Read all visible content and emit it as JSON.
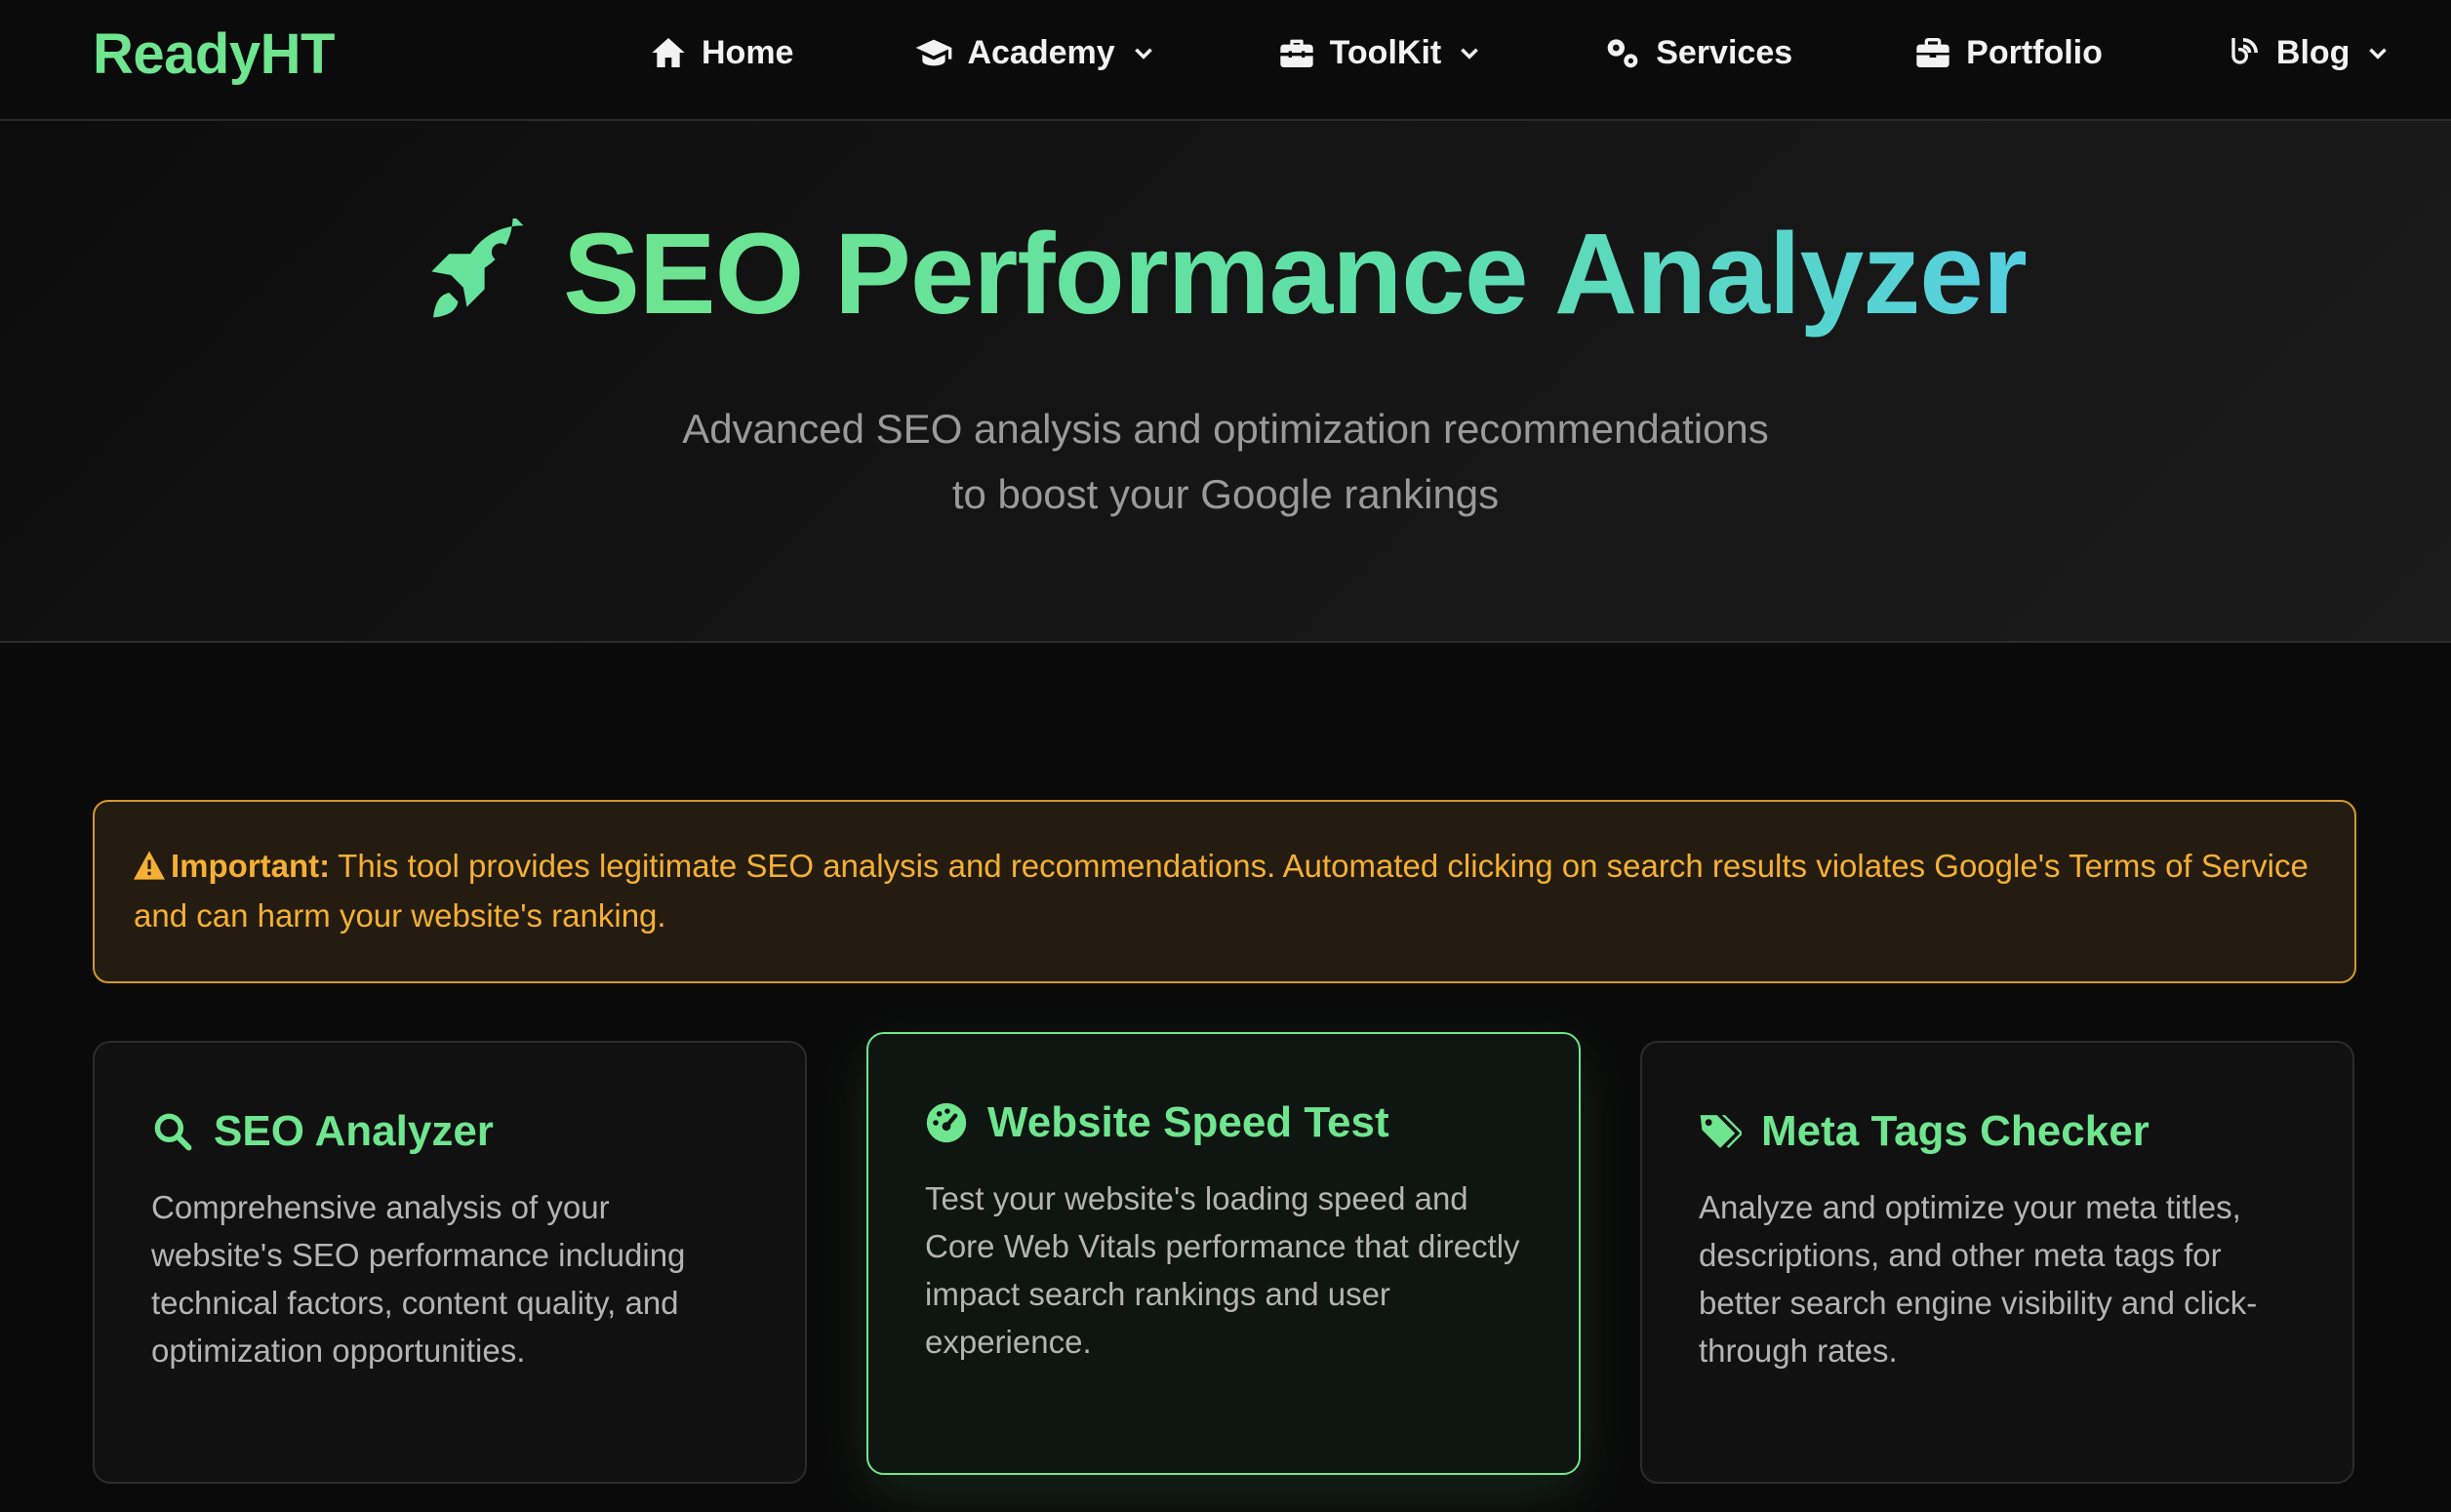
{
  "brand": "ReadyHT",
  "nav": {
    "items": [
      {
        "label": "Home",
        "icon": "home-icon",
        "dropdown": false
      },
      {
        "label": "Academy",
        "icon": "graduation-cap-icon",
        "dropdown": true
      },
      {
        "label": "ToolKit",
        "icon": "toolbox-icon",
        "dropdown": true
      },
      {
        "label": "Services",
        "icon": "gears-icon",
        "dropdown": false
      },
      {
        "label": "Portfolio",
        "icon": "briefcase-icon",
        "dropdown": false
      },
      {
        "label": "Blog",
        "icon": "blog-icon",
        "dropdown": true
      }
    ]
  },
  "hero": {
    "icon": "rocket-icon",
    "title": "SEO Performance Analyzer",
    "subtitle_line1": "Advanced SEO analysis and optimization recommendations",
    "subtitle_line2": "to boost your Google rankings"
  },
  "notice": {
    "icon": "warning-triangle-icon",
    "label": "Important:",
    "text": "This tool provides legitimate SEO analysis and recommendations. Automated clicking on search results violates Google's Terms of Service and can harm your website's ranking."
  },
  "cards": [
    {
      "icon": "search-icon",
      "title": "SEO Analyzer",
      "description": "Comprehensive analysis of your website's SEO performance including technical factors, content quality, and optimization opportunities.",
      "active": false
    },
    {
      "icon": "speedometer-icon",
      "title": "Website Speed Test",
      "description": "Test your website's loading speed and Core Web Vitals performance that directly impact search rankings and user experience.",
      "active": true
    },
    {
      "icon": "tags-icon",
      "title": "Meta Tags Checker",
      "description": "Analyze and optimize your meta titles, descriptions, and other meta tags for better search engine visibility and click-through rates.",
      "active": false
    }
  ],
  "colors": {
    "accent_green": "#6ee58e",
    "accent_cyan": "#55cfe0",
    "warning": "#f5b034",
    "background": "#0a0a0a"
  }
}
